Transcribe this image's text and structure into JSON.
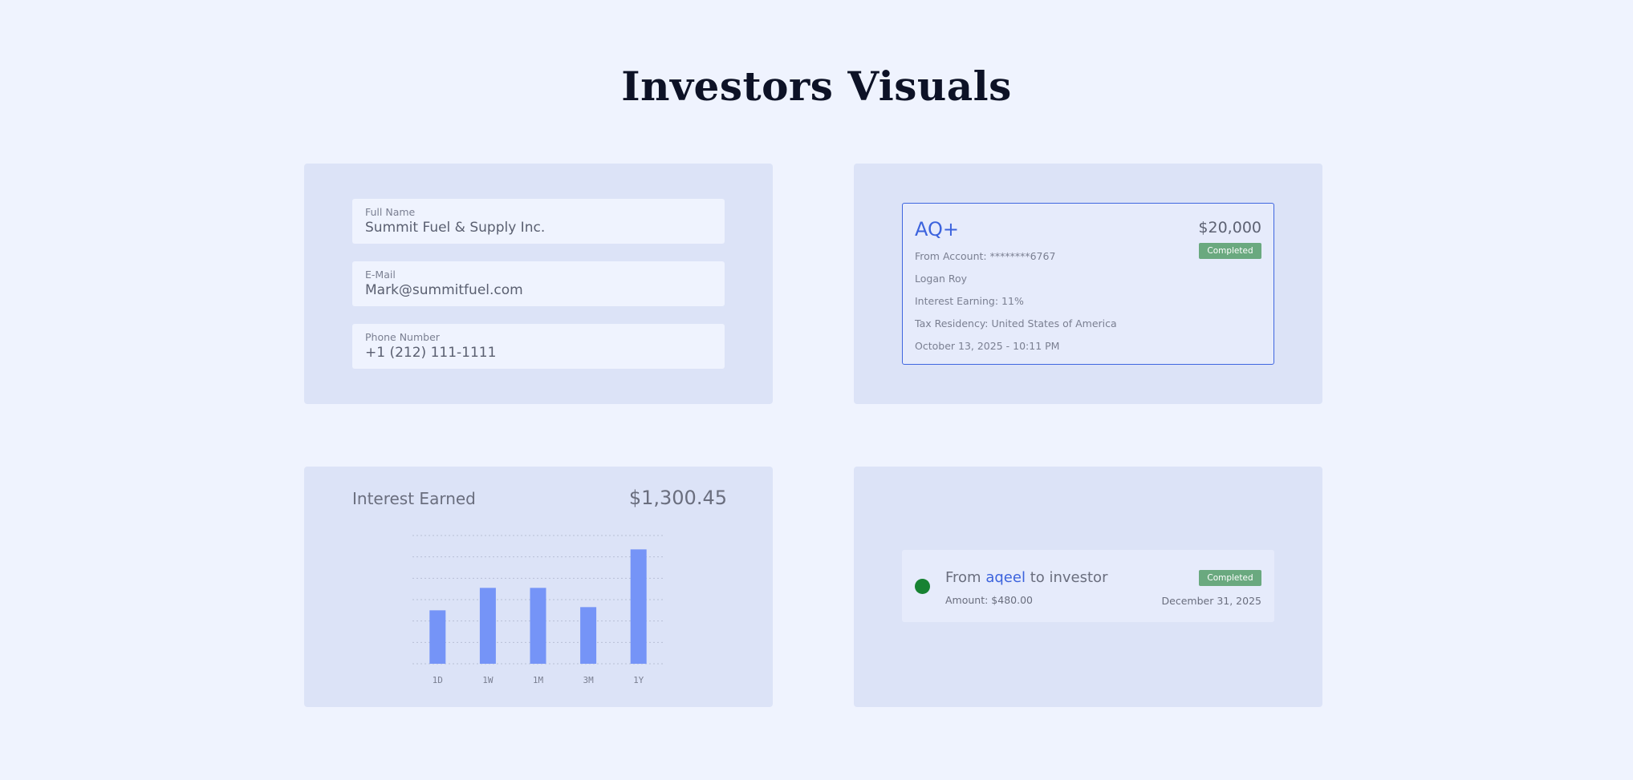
{
  "page": {
    "title": "Investors Visuals"
  },
  "contact_form": {
    "fields": [
      {
        "label": "Full Name",
        "value": "Summit Fuel & Supply Inc."
      },
      {
        "label": "E-Mail",
        "value": "Mark@summitfuel.com"
      },
      {
        "label": "Phone Number",
        "value": "+1 (212) 111-1111"
      }
    ]
  },
  "transaction": {
    "name": "AQ+",
    "amount": "$20,000",
    "status": "Completed",
    "from_account": "From Account: ********6767",
    "holder": "Logan Roy",
    "interest": "Interest Earning: 11%",
    "tax_residency": "Tax Residency: United States of America",
    "datetime": "October 13, 2025 - 10:11 PM"
  },
  "interest_card": {
    "title": "Interest Earned",
    "amount": "$1,300.45"
  },
  "chart_data": {
    "type": "bar",
    "categories": [
      "1D",
      "1W",
      "1M",
      "3M",
      "1Y"
    ],
    "values": [
      50,
      71,
      71,
      53,
      107
    ],
    "ylim": [
      0,
      120
    ],
    "grid": true,
    "grid_style": "dotted",
    "bar_color": "#7594f7"
  },
  "activity": {
    "prefix": "From",
    "link": "aqeel",
    "suffix": "to investor",
    "amount": "Amount: $480.00",
    "status": "Completed",
    "date": "December 31, 2025",
    "dot_color": "#178232"
  }
}
